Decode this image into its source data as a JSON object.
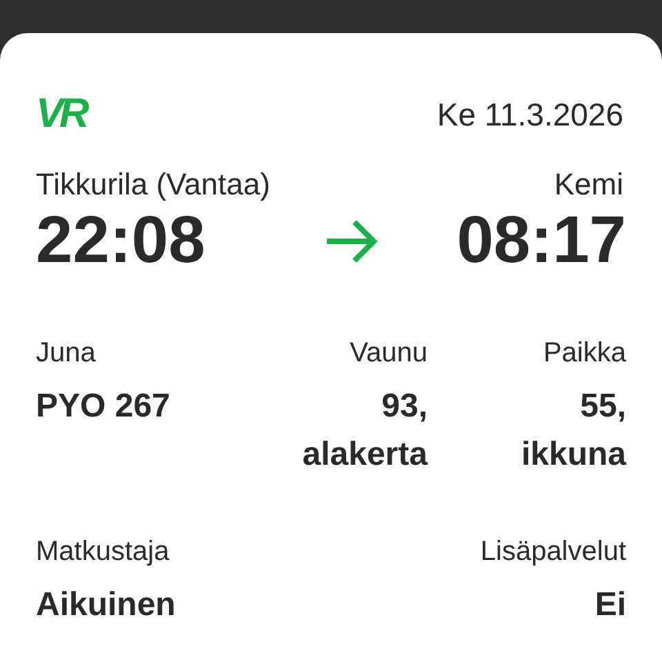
{
  "logo": "VR",
  "date": "Ke 11.3.2026",
  "route": {
    "from": {
      "station": "Tikkurila (Vantaa)",
      "time": "22:08"
    },
    "to": {
      "station": "Kemi",
      "time": "08:17"
    }
  },
  "details": [
    {
      "label": "Juna",
      "value": "PYO 267"
    },
    {
      "label": "Vaunu",
      "value": "93,\nalakerta"
    },
    {
      "label": "Paikka",
      "value": "55,\nikkuna"
    }
  ],
  "passenger": {
    "label": "Matkustaja",
    "value": "Aikuinen"
  },
  "extras": {
    "label": "Lisäpalvelut",
    "value": "Ei"
  }
}
